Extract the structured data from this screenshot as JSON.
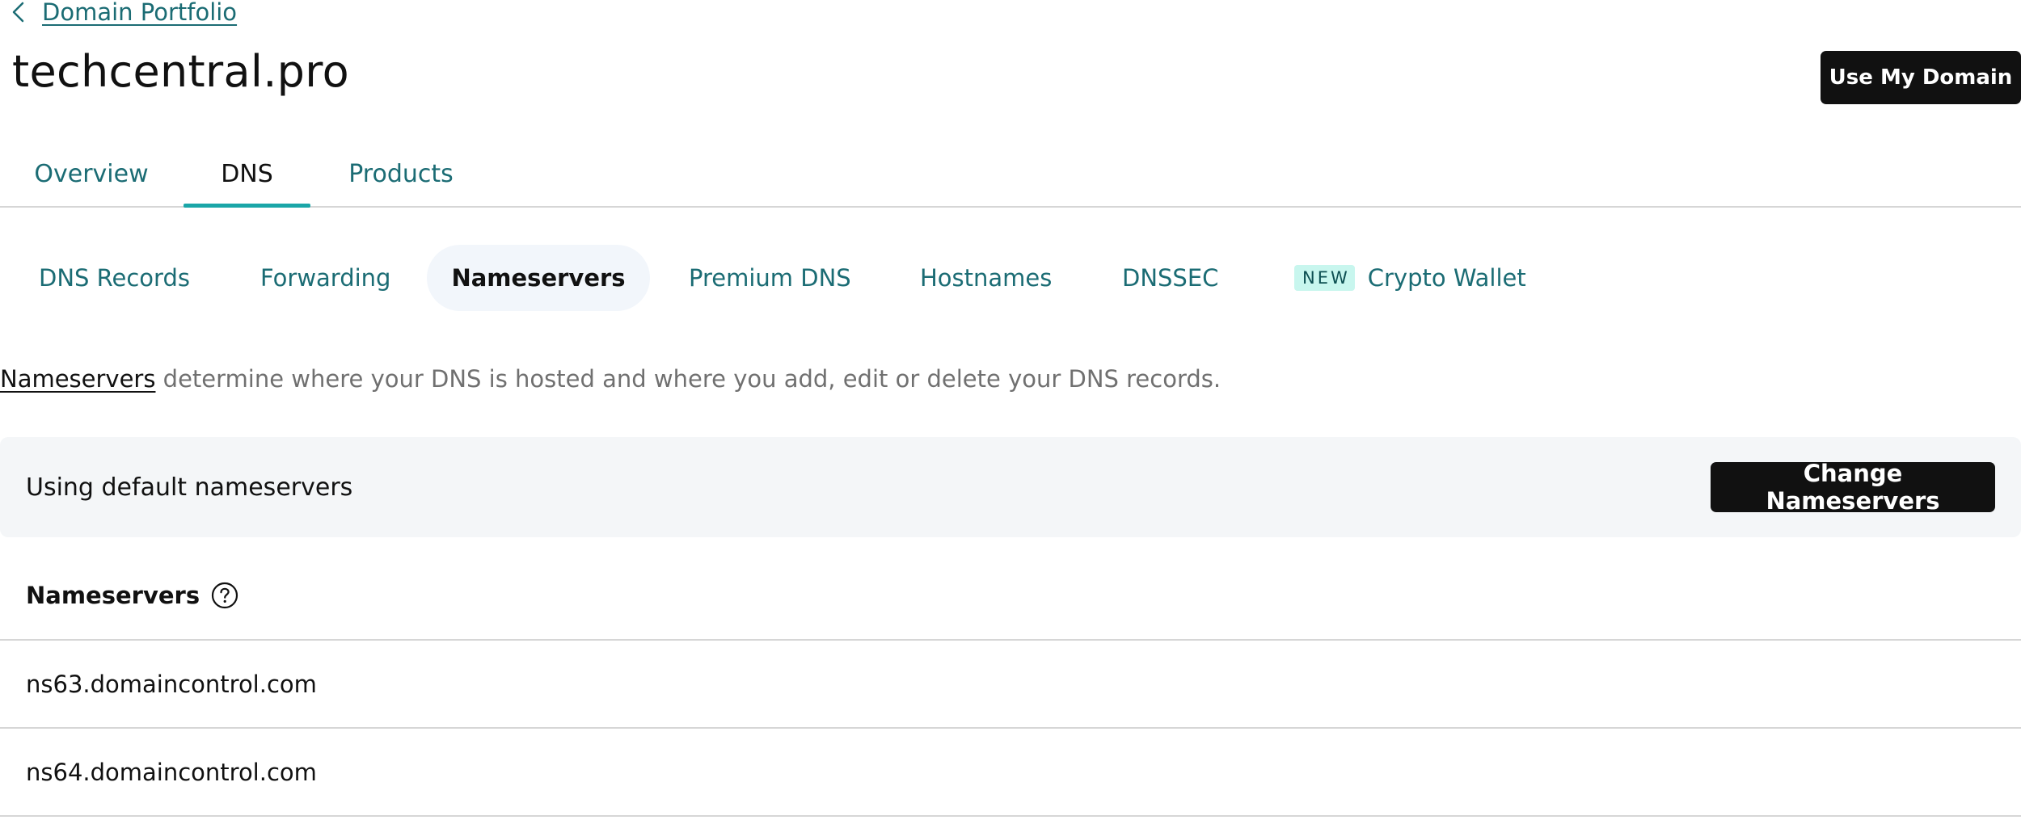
{
  "breadcrumb": {
    "back_label": "Domain Portfolio"
  },
  "header": {
    "title": "techcentral.pro",
    "use_domain_label": "Use My Domain"
  },
  "tabs": [
    {
      "label": "Overview",
      "active": false
    },
    {
      "label": "DNS",
      "active": true
    },
    {
      "label": "Products",
      "active": false
    }
  ],
  "subtabs": [
    {
      "label": "DNS Records",
      "active": false
    },
    {
      "label": "Forwarding",
      "active": false
    },
    {
      "label": "Nameservers",
      "active": true
    },
    {
      "label": "Premium DNS",
      "active": false
    },
    {
      "label": "Hostnames",
      "active": false
    },
    {
      "label": "DNSSEC",
      "active": false
    },
    {
      "label": "Crypto Wallet",
      "badge": "NEW",
      "active": false
    }
  ],
  "intro": {
    "link": "Nameservers",
    "text": " determine where your DNS is hosted and where you add, edit or delete your DNS records."
  },
  "status": {
    "text": "Using default nameservers",
    "change_label": "Change Nameservers"
  },
  "nameservers": {
    "header": "Nameservers",
    "help_icon": "question-circle-icon",
    "rows": [
      "ns63.domaincontrol.com",
      "ns64.domaincontrol.com"
    ]
  },
  "colors": {
    "accent_teal": "#1b6c74",
    "active_underline": "#1aa6a8",
    "badge_bg": "#c8f6ee",
    "button_dark": "#111111",
    "panel_bg": "#f4f6f8"
  }
}
